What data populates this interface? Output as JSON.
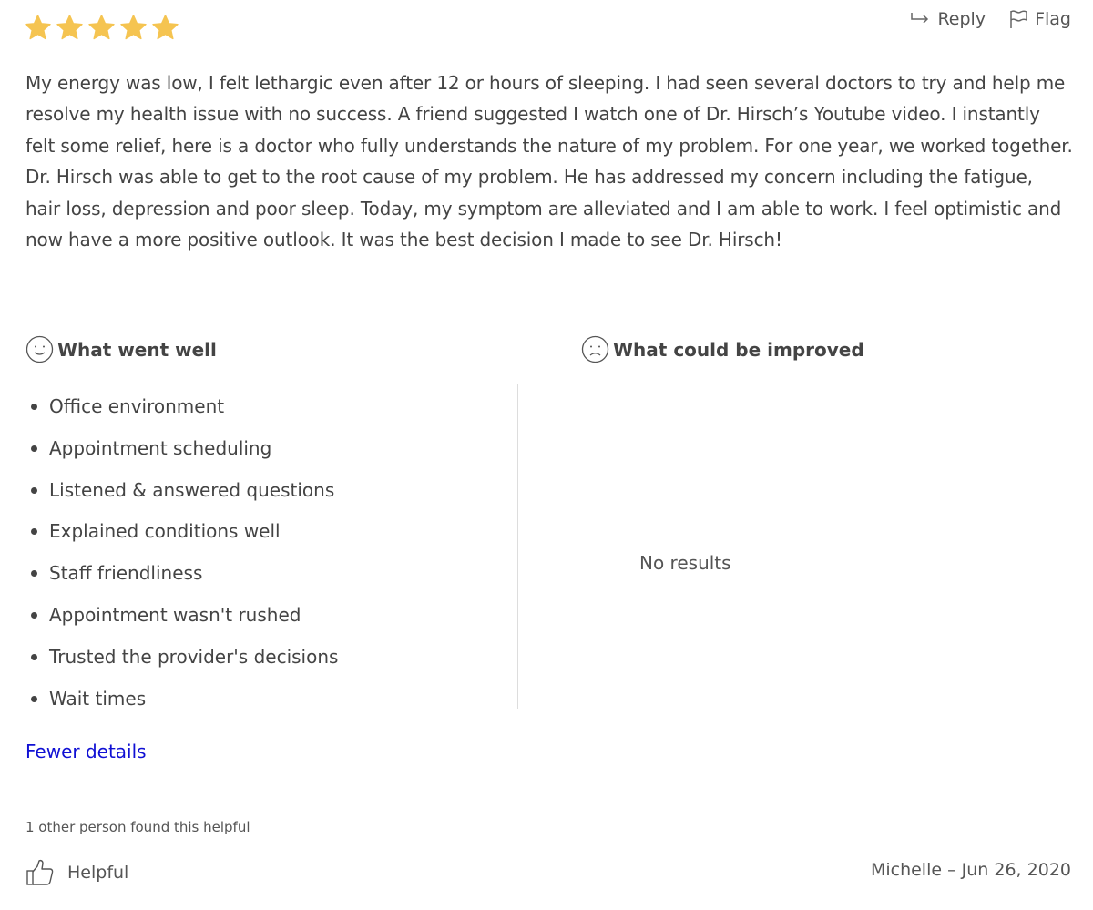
{
  "rating": {
    "stars": 5,
    "max": 5,
    "color": "#f5c451"
  },
  "actions": {
    "reply_label": "Reply",
    "flag_label": "Flag"
  },
  "review": {
    "text": "My energy was low, I felt lethargic even after 12 or hours of sleeping. I had seen several doctors to try and help me resolve my health issue with no success. A friend suggested I watch one of Dr. Hirsch’s Youtube video. I instantly felt some relief, here is a doctor who fully understands the nature of my problem. For one year, we worked together. Dr. Hirsch was able to get to the root cause of my problem. He has addressed my concern including the fatigue, hair loss, depression and poor sleep. Today, my symptom are alleviated and I am able to work. I feel optimistic and now have a more positive outlook. It was the best decision I made to see Dr. Hirsch!"
  },
  "went_well": {
    "heading": "What went well",
    "icon": "smile-face-icon",
    "items": [
      "Office environment",
      "Appointment scheduling",
      "Listened & answered questions",
      "Explained conditions well",
      "Staff friendliness",
      "Appointment wasn't rushed",
      "Trusted the provider's decisions",
      "Wait times"
    ]
  },
  "could_improve": {
    "heading": "What could be improved",
    "icon": "frown-face-icon",
    "empty_text": "No results"
  },
  "toggle": {
    "label": "Fewer details",
    "color": "#1010d4"
  },
  "helpful": {
    "count_text": "1 other person found this helpful",
    "button_label": "Helpful",
    "icon": "thumbs-up-icon"
  },
  "byline": {
    "author": "Michelle",
    "separator": "–",
    "date": "Jun 26, 2020"
  }
}
